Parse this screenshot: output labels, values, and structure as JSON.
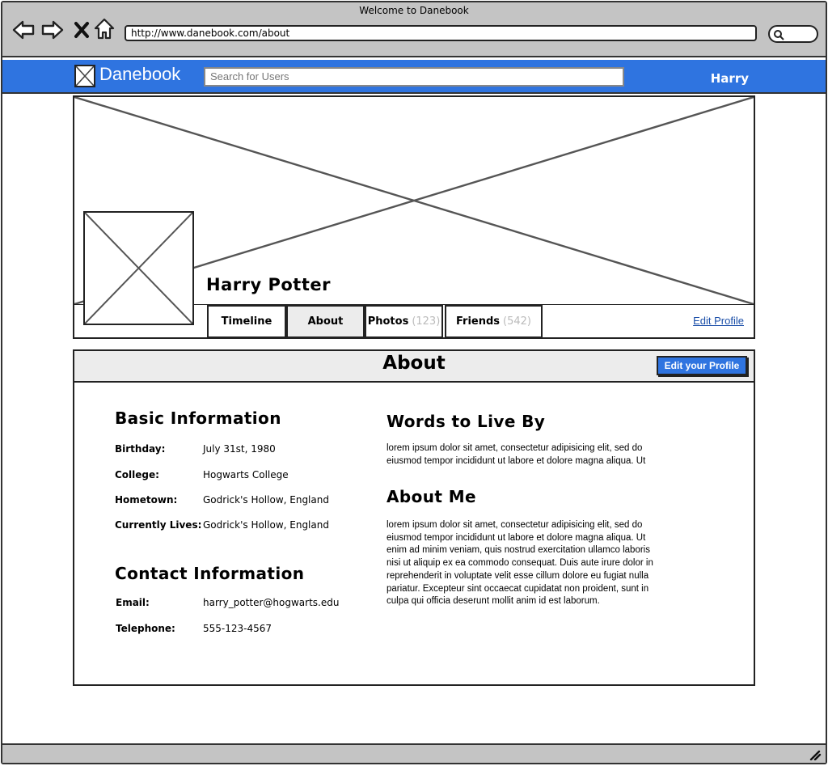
{
  "window": {
    "title": "Welcome to Danebook"
  },
  "browser": {
    "url": "http://www.danebook.com/about",
    "icons": [
      "back-arrow-icon",
      "forward-arrow-icon",
      "close-icon",
      "home-icon",
      "search-icon"
    ]
  },
  "app": {
    "brand": "Danebook",
    "search_placeholder": "Search for Users",
    "user_name": "Harry",
    "accent_color": "#2f74e0"
  },
  "profile": {
    "name": "Harry Potter",
    "tabs": [
      {
        "label": "Timeline",
        "count": ""
      },
      {
        "label": "About",
        "count": ""
      },
      {
        "label": "Photos",
        "count": "(123)"
      },
      {
        "label": "Friends",
        "count": "(542)"
      }
    ],
    "edit_link": "Edit Profile"
  },
  "about": {
    "title": "About",
    "edit_button": "Edit your Profile",
    "basic": {
      "heading": "Basic Information",
      "rows": [
        {
          "label": "Birthday:",
          "value": "July 31st, 1980"
        },
        {
          "label": "College:",
          "value": "Hogwarts College"
        },
        {
          "label": "Hometown:",
          "value": "Godrick's Hollow, England"
        },
        {
          "label": "Currently Lives:",
          "value": "Godrick's Hollow, England"
        }
      ]
    },
    "contact": {
      "heading": "Contact Information",
      "rows": [
        {
          "label": "Email:",
          "value": "harry_potter@hogwarts.edu"
        },
        {
          "label": "Telephone:",
          "value": "555-123-4567"
        }
      ]
    },
    "words": {
      "heading": "Words to Live By",
      "lines": [
        "lorem ipsum dolor sit amet, consectetur adipisicing elit, sed do",
        "eiusmod tempor incididunt ut labore et dolore magna aliqua. Ut"
      ]
    },
    "me": {
      "heading": "About Me",
      "lines": [
        "lorem ipsum dolor sit amet, consectetur adipisicing elit, sed do",
        "eiusmod tempor incididunt ut labore et dolore magna aliqua. Ut",
        "enim ad minim veniam, quis nostrud exercitation ullamco laboris",
        "nisi ut aliquip ex ea commodo consequat. Duis aute irure dolor in",
        "reprehenderit in voluptate velit esse cillum dolore eu fugiat nulla",
        "pariatur. Excepteur sint occaecat cupidatat non proident, sunt in",
        "culpa qui officia deserunt mollit anim id est laborum."
      ]
    }
  }
}
